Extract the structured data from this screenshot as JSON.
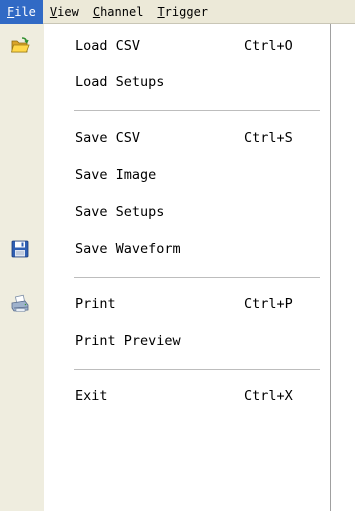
{
  "menubar": {
    "items": [
      {
        "label": "File",
        "accel": "F",
        "rest": "ile"
      },
      {
        "label": "View",
        "accel": "V",
        "rest": "iew"
      },
      {
        "label": "Channel",
        "accel": "C",
        "rest": "hannel"
      },
      {
        "label": "Trigger",
        "accel": "T",
        "rest": "rigger"
      }
    ]
  },
  "file_menu": {
    "items": [
      {
        "label": "Load CSV",
        "shortcut": "Ctrl+O",
        "icon": "folder-open-icon"
      },
      {
        "label": "Load Setups"
      },
      {
        "label": "Save CSV",
        "shortcut": "Ctrl+S"
      },
      {
        "label": "Save Image"
      },
      {
        "label": "Save Setups"
      },
      {
        "label": "Save Waveform",
        "icon": "floppy-disk-icon"
      },
      {
        "label": "Print",
        "shortcut": "Ctrl+P",
        "icon": "printer-icon"
      },
      {
        "label": "Print Preview"
      },
      {
        "label": "Exit",
        "shortcut": "Ctrl+X"
      }
    ]
  },
  "colors": {
    "menubar_bg": "#ece9d8",
    "highlight": "#316ac5",
    "gutter": "#efeddf"
  }
}
